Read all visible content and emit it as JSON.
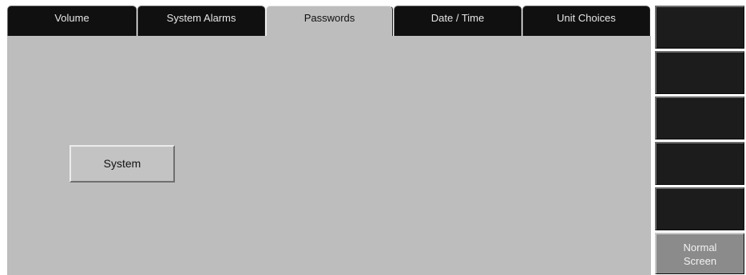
{
  "tabs": [
    {
      "label": "Volume",
      "active": false
    },
    {
      "label": "System Alarms",
      "active": false
    },
    {
      "label": "Passwords",
      "active": true
    },
    {
      "label": "Date / Time",
      "active": false
    },
    {
      "label": "Unit Choices",
      "active": false
    }
  ],
  "main": {
    "system_button_label": "System"
  },
  "side_panel": {
    "buttons": [
      "",
      "",
      "",
      "",
      ""
    ],
    "normal_screen": {
      "line1": "Normal",
      "line2": "Screen"
    }
  },
  "colors": {
    "tab_inactive": "#101010",
    "tab_active": "#bdbdbd",
    "content_bg": "#bdbdbd",
    "side_button": "#1c1c1c",
    "normal_screen_button": "#8b8b8b"
  }
}
